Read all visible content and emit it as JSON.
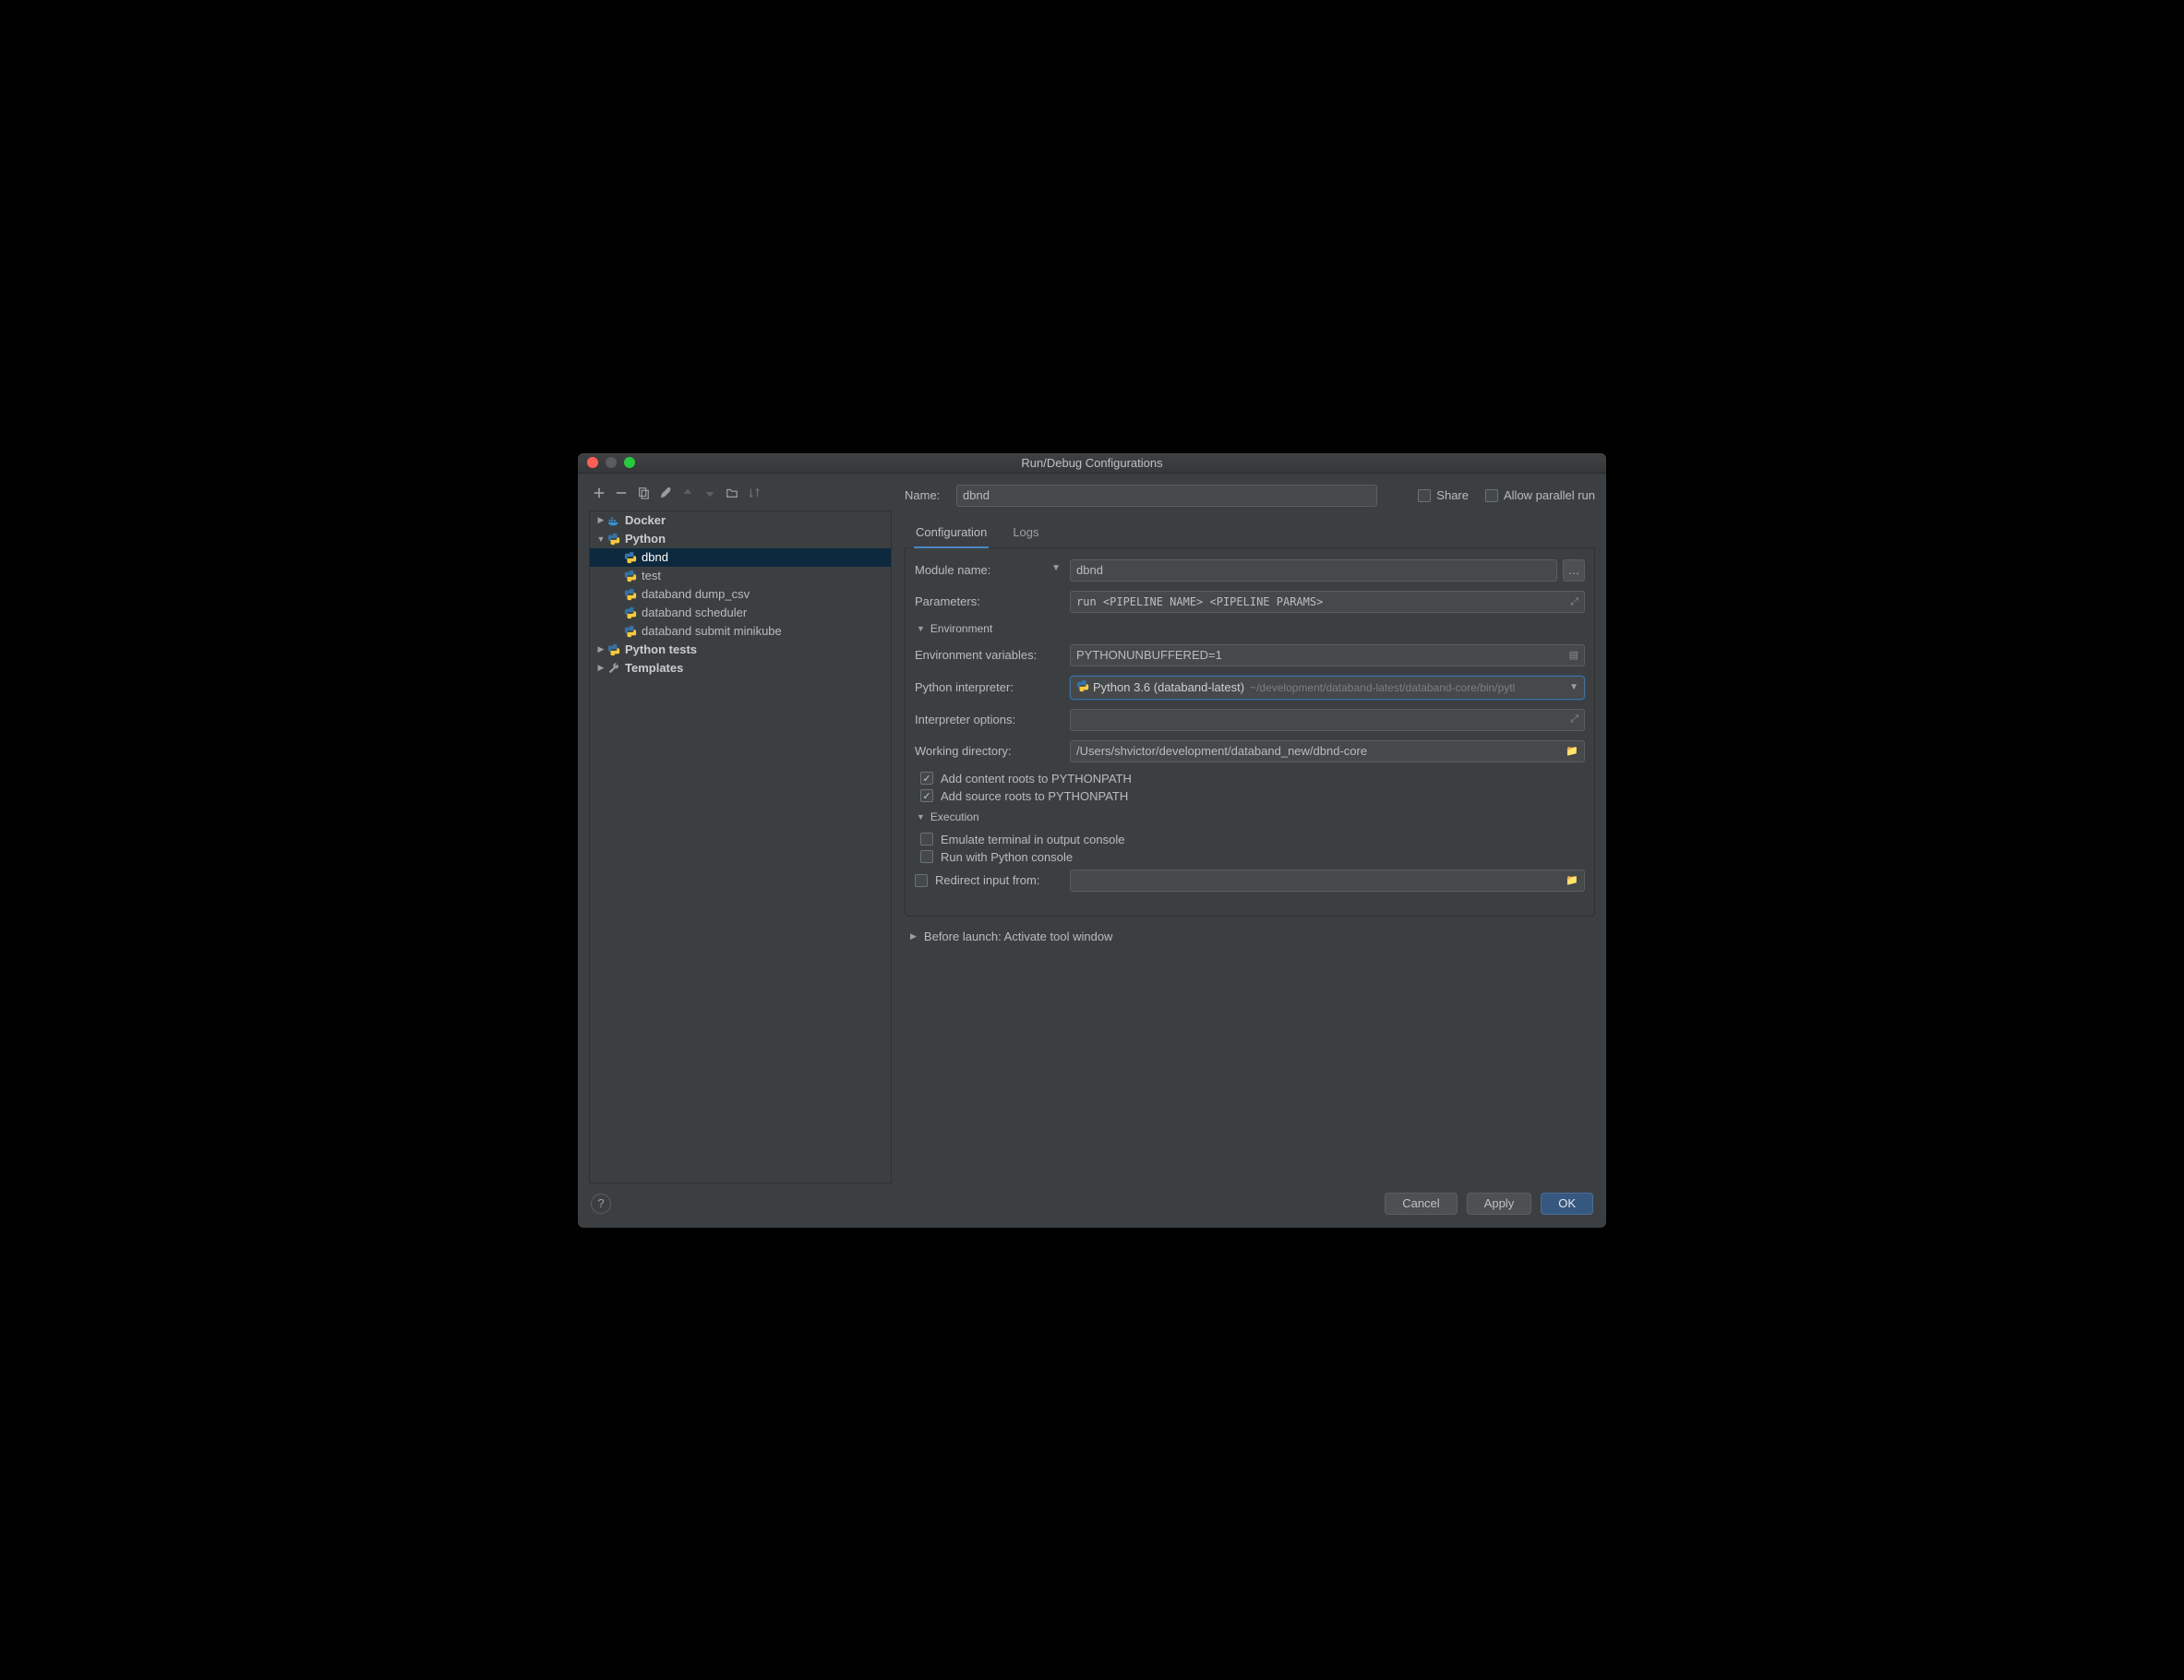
{
  "title": "Run/Debug Configurations",
  "name_label": "Name:",
  "name_value": "dbnd",
  "share_label": "Share",
  "parallel_label": "Allow parallel run",
  "tabs": {
    "configuration": "Configuration",
    "logs": "Logs"
  },
  "tree": {
    "docker": "Docker",
    "python": "Python",
    "python_items": [
      "dbnd",
      "test",
      "databand dump_csv",
      "databand scheduler",
      "databand submit minikube"
    ],
    "python_tests": "Python tests",
    "templates": "Templates"
  },
  "form": {
    "module_label": "Module name:",
    "module_value": "dbnd",
    "params_label": "Parameters:",
    "params_value": "run <PIPELINE NAME> <PIPELINE PARAMS>",
    "env_section": "Environment",
    "envvars_label": "Environment variables:",
    "envvars_value": "PYTHONUNBUFFERED=1",
    "interp_label": "Python interpreter:",
    "interp_name": "Python 3.6 (databand-latest)",
    "interp_path": "~/development/databand-latest/databand-core/bin/pytl",
    "interp_opts_label": "Interpreter options:",
    "workdir_label": "Working directory:",
    "workdir_value": "/Users/shvictor/development/databand_new/dbnd-core",
    "add_content_roots": "Add content roots to PYTHONPATH",
    "add_source_roots": "Add source roots to PYTHONPATH",
    "exec_section": "Execution",
    "emulate_terminal": "Emulate terminal in output console",
    "run_py_console": "Run with Python console",
    "redirect_input": "Redirect input from:"
  },
  "before_launch": "Before launch: Activate tool window",
  "buttons": {
    "cancel": "Cancel",
    "apply": "Apply",
    "ok": "OK"
  }
}
